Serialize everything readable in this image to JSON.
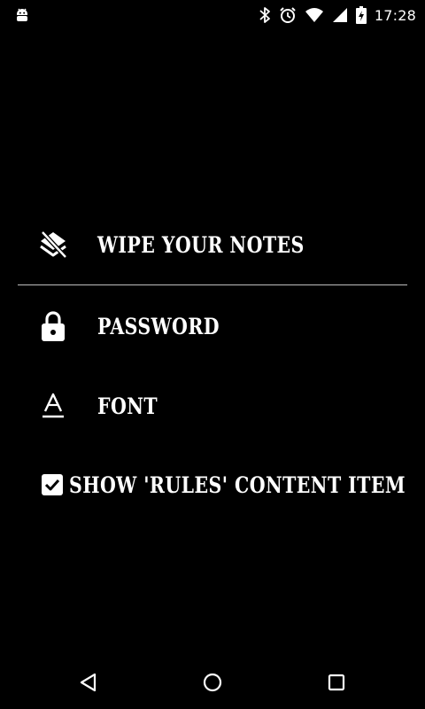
{
  "status_bar": {
    "time": "17:28",
    "icons": [
      "android-icon",
      "bluetooth-icon",
      "alarm-icon",
      "wifi-icon",
      "signal-icon",
      "battery-charging-icon"
    ]
  },
  "menu": {
    "items": [
      {
        "label": "WIPE YOUR NOTES",
        "icon": "layers-clear-icon"
      },
      {
        "label": "PASSWORD",
        "icon": "lock-icon"
      },
      {
        "label": "FONT",
        "icon": "text-format-icon"
      }
    ],
    "checkbox": {
      "label": "SHOW 'RULES' CONTENT ITEM",
      "checked": true
    }
  },
  "nav_bar": {
    "buttons": [
      "back-icon",
      "home-icon",
      "recents-icon"
    ]
  },
  "colors": {
    "background": "#000000",
    "foreground": "#ffffff",
    "divider": "#bdbdbd"
  }
}
